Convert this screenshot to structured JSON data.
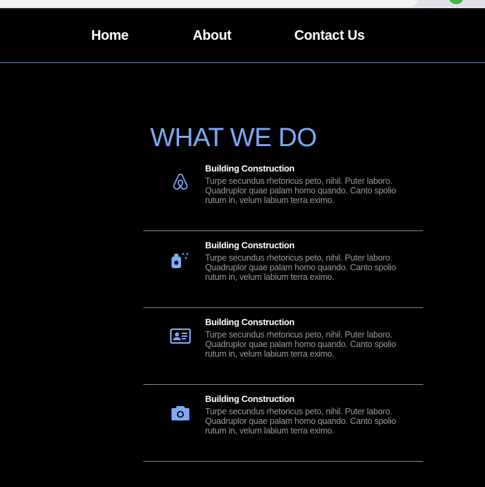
{
  "nav": {
    "items": [
      {
        "label": "Home"
      },
      {
        "label": "About"
      },
      {
        "label": "Contact Us"
      }
    ]
  },
  "section": {
    "title": "WHAT WE DO"
  },
  "accent_color": "#7eaaf5",
  "services": [
    {
      "icon": "airbnb-icon",
      "title": "Building Construction",
      "description": "Turpe secundus rhetoricus peto, nihil. Puter laboro. Quadruplor quae palam homo quando. Canto spolio rutum in, velum labium terra eximo."
    },
    {
      "icon": "spray-bottle-sparkle-icon",
      "title": "Building Construction",
      "description": "Turpe secundus rhetoricus peto, nihil. Puter laboro. Quadruplor quae palam homo quando. Canto spolio rutum in, velum labium terra eximo."
    },
    {
      "icon": "id-card-icon",
      "title": "Building Construction",
      "description": "Turpe secundus rhetoricus peto, nihil. Puter laboro. Quadruplor quae palam homo quando. Canto spolio rutum in, velum labium terra eximo."
    },
    {
      "icon": "camera-icon",
      "title": "Building Construction",
      "description": "Turpe secundus rhetoricus peto, nihil. Puter laboro. Quadruplor quae palam homo quando. Canto spolio rutum in, velum labium terra eximo."
    }
  ]
}
